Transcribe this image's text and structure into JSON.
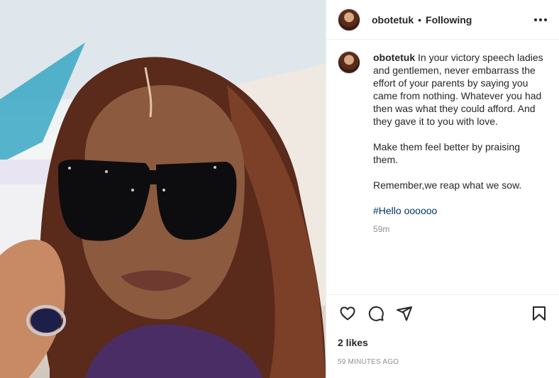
{
  "post": {
    "username": "obotetuk",
    "separator": "•",
    "follow_status": "Following",
    "caption": {
      "username": "obotetuk",
      "text": "In your victory speech ladies and gentlemen, never embarrass the effort of your parents by saying you came from nothing. Whatever you had then was what they could afford. And they gave it to you with love.",
      "paragraph2": "Make them feel better by praising them.",
      "paragraph3": "Remember,we reap what we sow.",
      "hashtag": "#Hello oooooo",
      "relative_time": "59m"
    },
    "likes": "2 likes",
    "timestamp": "59 MINUTES AGO"
  },
  "icons": {
    "more": "more-options-icon",
    "like": "heart-icon",
    "comment": "comment-icon",
    "share": "share-icon",
    "save": "bookmark-icon"
  },
  "colors": {
    "text": "#262626",
    "secondary": "#8e8e8e",
    "link": "#00376b",
    "border": "#efefef"
  }
}
